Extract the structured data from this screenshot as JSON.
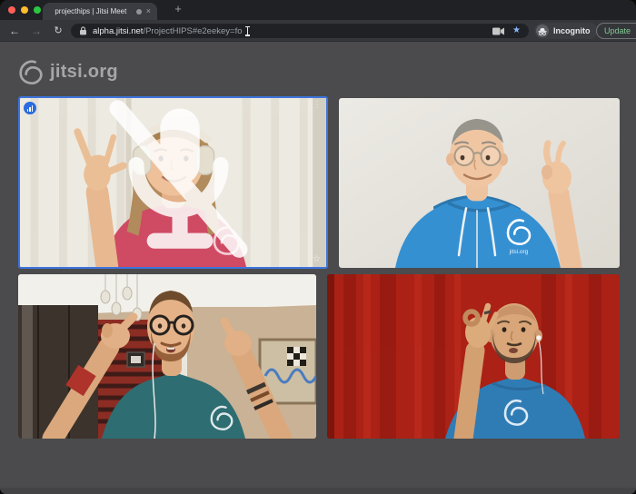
{
  "browser": {
    "window_controls": {
      "close_color": "#ff5f57",
      "minimize_color": "#febc2e",
      "zoom_color": "#28c840"
    },
    "tab": {
      "title": "projecthips | Jitsi Meet"
    },
    "toolbar": {
      "url_domain": "alpha.jitsi.net",
      "url_path": "/ProjectHIPS#e2eekey=fo",
      "incognito_label": "Incognito",
      "update_label": "Update"
    }
  },
  "icons": {
    "back": "←",
    "forward": "→",
    "reload": "↻",
    "close_tab": "×",
    "new_tab": "+",
    "kebab": "⋮",
    "star_outline": "☆",
    "bookmark_star": "★"
  },
  "page": {
    "watermark": "jitsi.org",
    "background_color": "#4b4b4d",
    "active_speaker_border": "#3d74dd"
  },
  "participants": [
    {
      "position": "top-left",
      "description": "Woman with white headphones and pink Jitsi t-shirt raising hand in sign",
      "active_speaker": true,
      "badges": [
        "connection-quality",
        "tile-menu",
        "muted-mic",
        "star"
      ]
    },
    {
      "position": "top-right",
      "description": "Man with glasses in blue Jitsi hoodie making pinch gesture",
      "shirt_label": "jitsi.org",
      "active_speaker": false,
      "badges": [
        "tile-menu"
      ]
    },
    {
      "position": "bottom-left",
      "description": "Bearded man with round glasses in teal shirt raising both fists",
      "active_speaker": false,
      "badges": [
        "tile-menu"
      ]
    },
    {
      "position": "bottom-right",
      "description": "Bald bearded man in blue Jitsi t-shirt making OK gesture against red curtain",
      "active_speaker": false,
      "badges": []
    }
  ]
}
